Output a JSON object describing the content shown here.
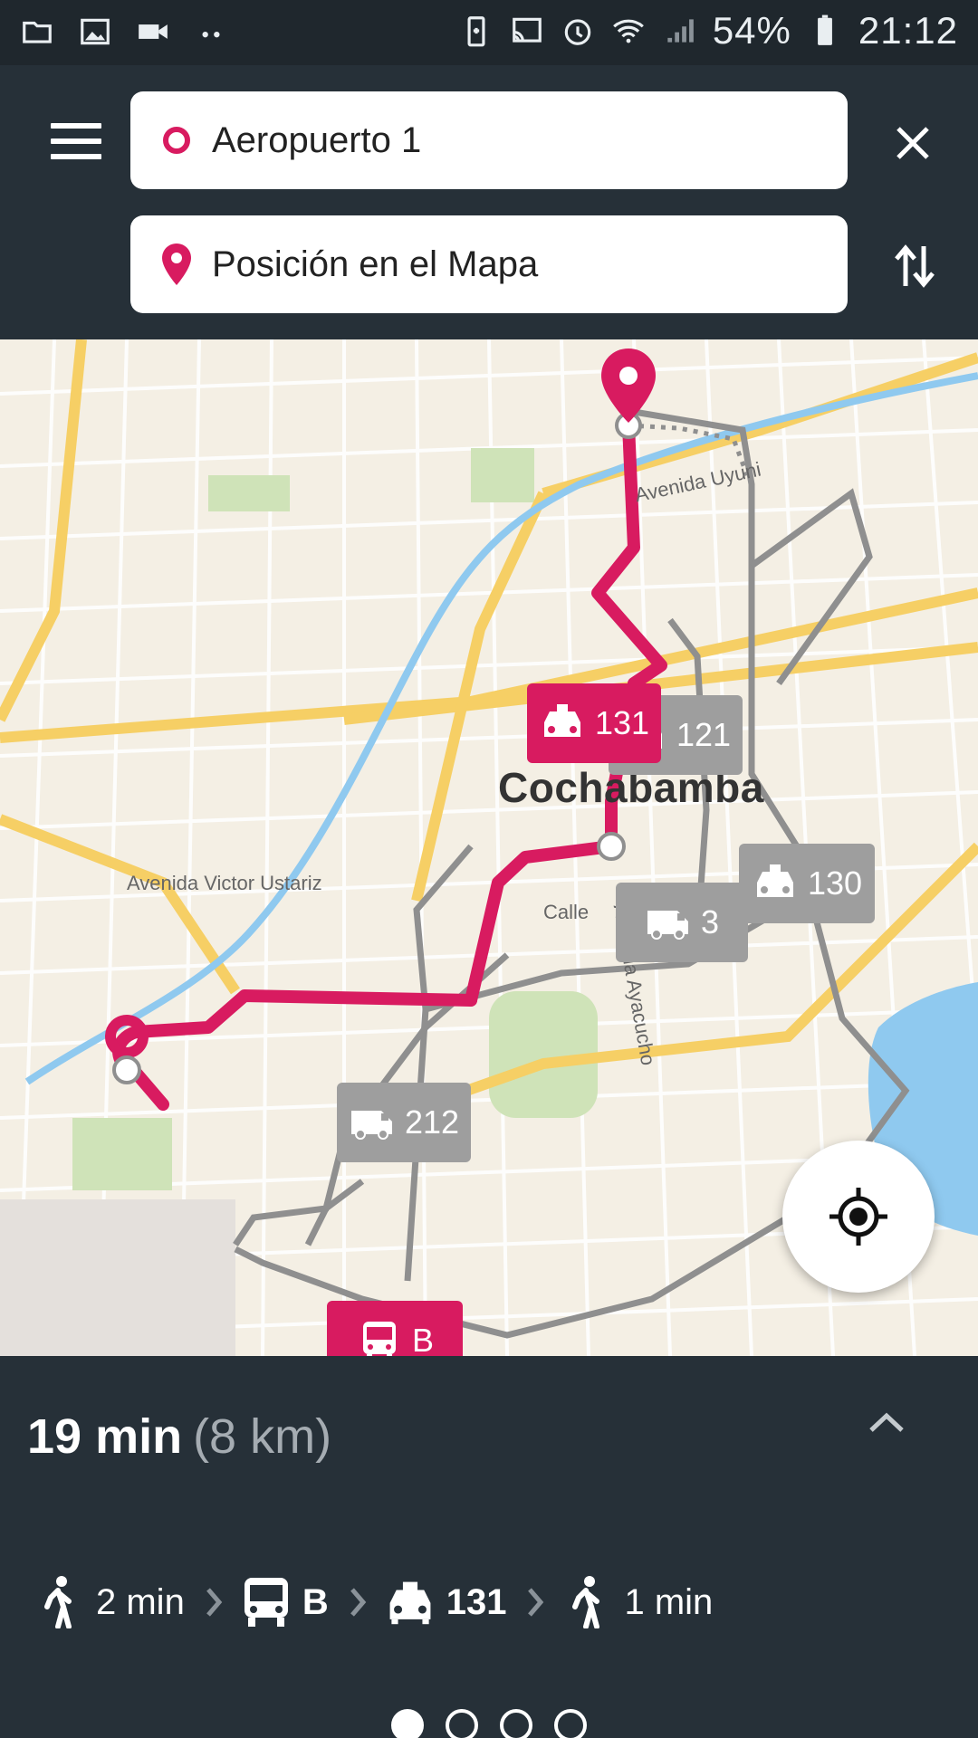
{
  "status_bar": {
    "battery": "54%",
    "time": "21:12",
    "left_icons": [
      "folder-icon",
      "image-icon",
      "video-camera-icon",
      "more-dots-icon"
    ],
    "right_icons": [
      "battery-saver-icon",
      "cast-icon",
      "alarm-icon",
      "wifi-icon",
      "signal-icon",
      "battery-icon"
    ]
  },
  "search": {
    "origin": "Aeropuerto 1",
    "destination": "Posición en el Mapa"
  },
  "map": {
    "city": "Cochabamba",
    "streets": [
      "Avenida Uyuni",
      "Avenida Victor Ustariz",
      "Avenida Ayacucho",
      "Calle"
    ],
    "route_badges": [
      {
        "type": "taxi",
        "label": "131",
        "style": "pink"
      },
      {
        "type": "bus",
        "label": "B",
        "style": "pink"
      },
      {
        "type": "taxi",
        "label": "121",
        "style": "gray"
      },
      {
        "type": "taxi",
        "label": "130",
        "style": "gray"
      },
      {
        "type": "van",
        "label": "3",
        "style": "gray"
      },
      {
        "type": "van",
        "label": "212",
        "style": "gray"
      }
    ]
  },
  "route": {
    "duration": "19 min",
    "distance": "(8 km)",
    "steps": [
      {
        "icon": "walk-icon",
        "label": "2 min",
        "bold": false
      },
      {
        "icon": "bus-icon",
        "label": "B",
        "bold": true
      },
      {
        "icon": "taxi-icon",
        "label": "131",
        "bold": true
      },
      {
        "icon": "walk-icon",
        "label": "1 min",
        "bold": false
      }
    ],
    "pages": 4,
    "active_page": 1
  },
  "colors": {
    "accent": "#d81b60",
    "panel": "#263038",
    "transit_alt": "#9e9e9e"
  }
}
